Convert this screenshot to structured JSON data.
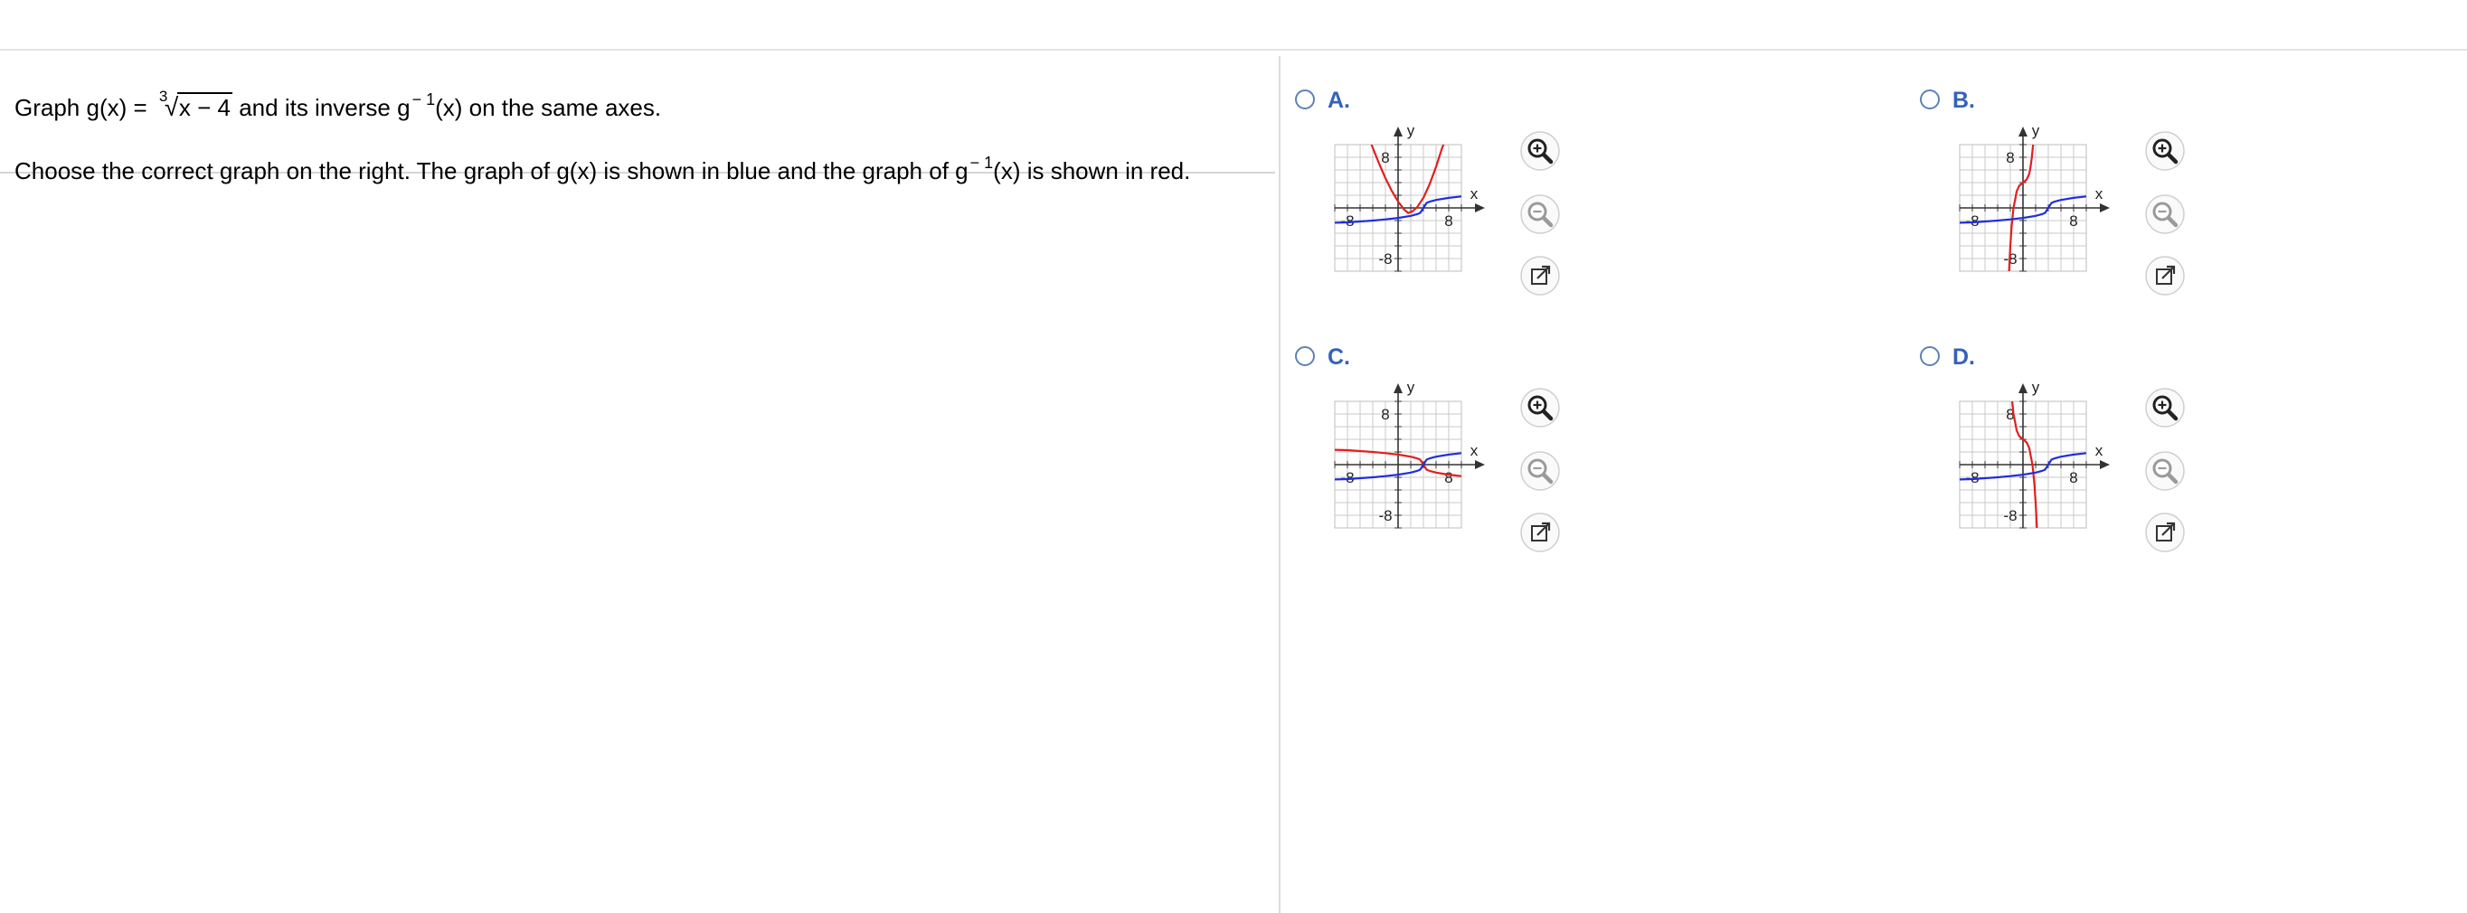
{
  "question": {
    "line1": {
      "prefix": "Graph g(x) = ",
      "radical_index": "3",
      "radicand": "x − 4",
      "middle": " and its inverse g",
      "superscript": "− 1",
      "suffix": "(x) on the same axes."
    },
    "line2": {
      "prefix": "Choose the correct graph on the right. The graph of g(x) is shown in blue and the graph of g",
      "superscript": "− 1",
      "suffix": "(x) is shown in red."
    }
  },
  "colors": {
    "g_curve": "#1f2ee0",
    "inverse_curve": "#e21f1f",
    "option_letter": "#3462b8",
    "radio_border": "#5d82b8",
    "grid": "#c9c9c9"
  },
  "icons": {
    "zoom_in": "magnifier-plus-icon",
    "zoom_out": "magnifier-minus-icon",
    "popout": "external-link-icon",
    "radio": "radio-circle-icon"
  },
  "options": [
    {
      "letter": "A.",
      "graph": {
        "x_label": "x",
        "y_label": "y",
        "x_min_label": "-8",
        "x_max_label": "8",
        "y_max_label": "8",
        "y_min_label": "-8",
        "g_curve": [
          [
            -10,
            -2.34
          ],
          [
            -8,
            -2.29
          ],
          [
            -6,
            -2.15
          ],
          [
            -4,
            -2
          ],
          [
            -2,
            -1.82
          ],
          [
            0,
            -1.59
          ],
          [
            2,
            -1.26
          ],
          [
            3,
            -1
          ],
          [
            3.5,
            -0.79
          ],
          [
            4,
            0
          ],
          [
            4.5,
            0.79
          ],
          [
            5,
            1
          ],
          [
            6,
            1.26
          ],
          [
            8,
            1.59
          ],
          [
            10,
            1.82
          ]
        ],
        "inverse_curve": [
          [
            -4.2,
            10
          ],
          [
            -4,
            9.5
          ],
          [
            -3,
            7
          ],
          [
            -2,
            4.7
          ],
          [
            -1,
            2.7
          ],
          [
            0,
            1
          ],
          [
            1,
            -0.3
          ],
          [
            1.6,
            -0.8
          ],
          [
            2.2,
            -0.6
          ],
          [
            3,
            0.1
          ],
          [
            4,
            1.6
          ],
          [
            5,
            3.8
          ],
          [
            6,
            6.5
          ],
          [
            7,
            9.6
          ],
          [
            7.2,
            10
          ]
        ]
      }
    },
    {
      "letter": "B.",
      "graph": {
        "x_label": "x",
        "y_label": "y",
        "x_min_label": "-8",
        "x_max_label": "8",
        "y_max_label": "8",
        "y_min_label": "-8",
        "g_curve": [
          [
            -10,
            -2.34
          ],
          [
            -8,
            -2.29
          ],
          [
            -6,
            -2.15
          ],
          [
            -4,
            -2
          ],
          [
            -2,
            -1.82
          ],
          [
            0,
            -1.59
          ],
          [
            2,
            -1.26
          ],
          [
            3,
            -1
          ],
          [
            3.5,
            -0.79
          ],
          [
            4,
            0
          ],
          [
            4.5,
            0.79
          ],
          [
            5,
            1
          ],
          [
            6,
            1.26
          ],
          [
            8,
            1.59
          ],
          [
            10,
            1.82
          ]
        ],
        "inverse_curve": [
          [
            -2.2,
            -10
          ],
          [
            -2.1,
            -8
          ],
          [
            -2,
            -6
          ],
          [
            -1.8,
            -3
          ],
          [
            -1.5,
            0
          ],
          [
            -1.2,
            1.5
          ],
          [
            -1,
            2.6
          ],
          [
            -0.6,
            3.5
          ],
          [
            0,
            4
          ],
          [
            0.6,
            4.5
          ],
          [
            1,
            5.4
          ],
          [
            1.2,
            6.5
          ],
          [
            1.4,
            8
          ],
          [
            1.6,
            10
          ]
        ]
      }
    },
    {
      "letter": "C.",
      "graph": {
        "x_label": "x",
        "y_label": "y",
        "x_min_label": "-8",
        "x_max_label": "8",
        "y_max_label": "8",
        "y_min_label": "-8",
        "g_curve": [
          [
            -10,
            -2.34
          ],
          [
            -8,
            -2.29
          ],
          [
            -6,
            -2.15
          ],
          [
            -4,
            -2
          ],
          [
            -2,
            -1.82
          ],
          [
            0,
            -1.59
          ],
          [
            2,
            -1.26
          ],
          [
            3,
            -1
          ],
          [
            3.5,
            -0.79
          ],
          [
            4,
            0
          ],
          [
            4.5,
            0.79
          ],
          [
            5,
            1
          ],
          [
            6,
            1.26
          ],
          [
            8,
            1.59
          ],
          [
            10,
            1.82
          ]
        ],
        "inverse_curve": [
          [
            -10,
            2.34
          ],
          [
            -8,
            2.29
          ],
          [
            -6,
            2.15
          ],
          [
            -4,
            2
          ],
          [
            -2,
            1.82
          ],
          [
            0,
            1.59
          ],
          [
            2,
            1.26
          ],
          [
            3,
            1
          ],
          [
            3.5,
            0.79
          ],
          [
            4,
            0
          ],
          [
            4.5,
            -0.79
          ],
          [
            5,
            -1
          ],
          [
            6,
            -1.26
          ],
          [
            8,
            -1.59
          ],
          [
            10,
            -1.82
          ]
        ]
      }
    },
    {
      "letter": "D.",
      "graph": {
        "x_label": "x",
        "y_label": "y",
        "x_min_label": "-8",
        "x_max_label": "8",
        "y_max_label": "8",
        "y_min_label": "-8",
        "g_curve": [
          [
            -10,
            -2.34
          ],
          [
            -8,
            -2.29
          ],
          [
            -6,
            -2.15
          ],
          [
            -4,
            -2
          ],
          [
            -2,
            -1.82
          ],
          [
            0,
            -1.59
          ],
          [
            2,
            -1.26
          ],
          [
            3,
            -1
          ],
          [
            3.5,
            -0.79
          ],
          [
            4,
            0
          ],
          [
            4.5,
            0.79
          ],
          [
            5,
            1
          ],
          [
            6,
            1.26
          ],
          [
            8,
            1.59
          ],
          [
            10,
            1.82
          ]
        ],
        "inverse_curve": [
          [
            -1.7,
            10
          ],
          [
            -1.5,
            8
          ],
          [
            -1.2,
            6.5
          ],
          [
            -1,
            5.4
          ],
          [
            -0.6,
            4.5
          ],
          [
            0,
            4
          ],
          [
            0.6,
            3.5
          ],
          [
            1,
            2.6
          ],
          [
            1.2,
            1.5
          ],
          [
            1.5,
            0
          ],
          [
            1.8,
            -3
          ],
          [
            2,
            -6
          ],
          [
            2.1,
            -8
          ],
          [
            2.2,
            -10
          ]
        ]
      }
    }
  ]
}
